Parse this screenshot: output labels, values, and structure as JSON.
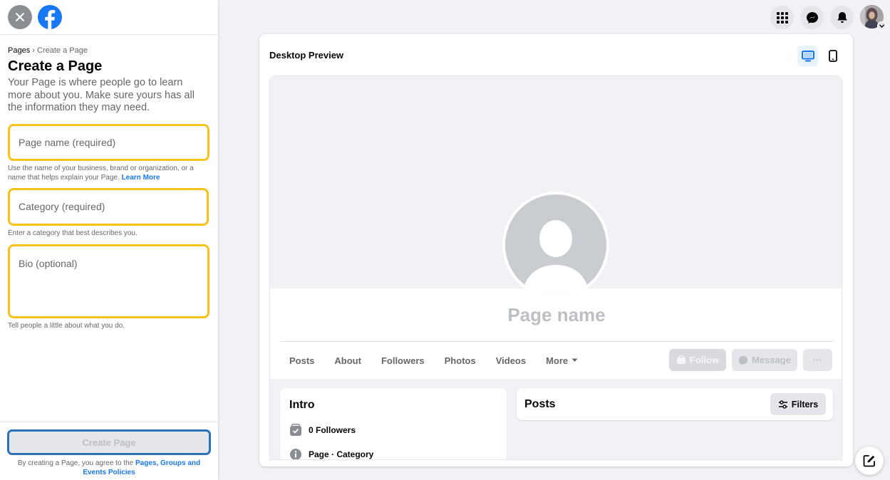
{
  "colors": {
    "facebook_blue": "#1877f2",
    "field_highlight": "#f7c21a",
    "button_highlight": "#2b73b6",
    "secondary_text": "#65676b",
    "disabled_text": "#bcc0c4"
  },
  "icons": {
    "close": "close-icon",
    "logo": "facebook-logo-icon",
    "menu": "grid-menu-icon",
    "messenger": "messenger-icon",
    "notifications": "bell-icon",
    "desktop": "desktop-icon",
    "mobile": "mobile-icon",
    "compose": "compose-icon"
  },
  "breadcrumb": {
    "root": "Pages",
    "separator": "›",
    "current": "Create a Page"
  },
  "form": {
    "title": "Create a Page",
    "description": "Your Page is where people go to learn more about you. Make sure yours has all the information they may need.",
    "page_name_placeholder": "Page name (required)",
    "page_name_hint": "Use the name of your business, brand or organization, or a name that helps explain your Page.",
    "learn_more": "Learn More",
    "category_placeholder": "Category (required)",
    "category_hint": "Enter a category that best describes you.",
    "bio_placeholder": "Bio (optional)",
    "bio_hint": "Tell people a little about what you do.",
    "create_button": "Create Page",
    "terms_prefix": "By creating a Page, you agree to the",
    "terms_link": "Pages, Groups and Events Policies"
  },
  "preview": {
    "title": "Desktop Preview",
    "page_name": "Page name",
    "tabs": [
      "Posts",
      "About",
      "Followers",
      "Photos",
      "Videos",
      "More"
    ],
    "follow": "Follow",
    "message": "Message",
    "more_actions": "···",
    "intro_title": "Intro",
    "followers": "0 Followers",
    "page_category": "Page · Category",
    "posts_title": "Posts",
    "filters": "Filters"
  }
}
